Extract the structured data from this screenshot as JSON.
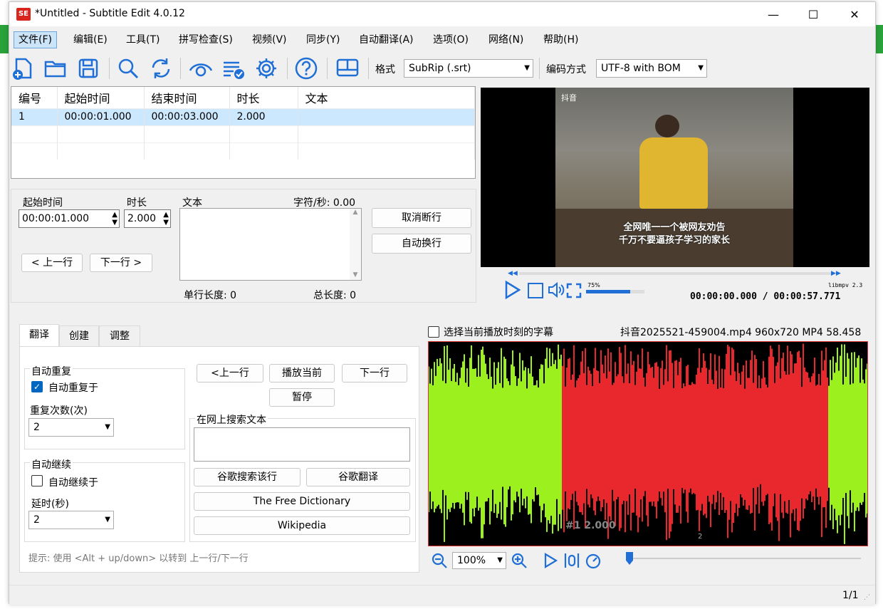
{
  "window": {
    "title": "*Untitled - Subtitle Edit 4.0.12",
    "min": "—",
    "max": "☐",
    "close": "✕",
    "logo": "SE"
  },
  "menu": [
    "文件(F)",
    "编辑(E)",
    "工具(T)",
    "拼写检查(S)",
    "视频(V)",
    "同步(Y)",
    "自动翻译(A)",
    "选项(O)",
    "网络(N)",
    "帮助(H)"
  ],
  "toolbar": {
    "format_label": "格式",
    "format_value": "SubRip (.srt)",
    "encoding_label": "编码方式",
    "encoding_value": "UTF-8 with BOM"
  },
  "grid": {
    "headers": [
      "编号",
      "起始时间",
      "结束时间",
      "时长",
      "文本"
    ],
    "rows": [
      [
        "1",
        "00:00:01.000",
        "00:00:03.000",
        "2.000",
        ""
      ]
    ]
  },
  "edit": {
    "start_label": "起始时间",
    "duration_label": "时长",
    "text_label": "文本",
    "cps": "字符/秒: 0.00",
    "start_value": "00:00:01.000",
    "duration_value": "2.000",
    "unbreak": "取消断行",
    "autobreak": "自动换行",
    "prev": "< 上一行",
    "next": "下一行 >",
    "line_len": "单行长度: 0",
    "total_len": "总长度: 0"
  },
  "video": {
    "watermark": "抖音",
    "sub1": "全网唯一一个被网友劝告",
    "sub2": "千万不要逼孩子学习的家长",
    "volume": "75%",
    "engine": "libmpv 2.3",
    "time": "00:00:00.000 / 00:00:57.771"
  },
  "tabs": [
    "翻译",
    "创建",
    "调整"
  ],
  "translate": {
    "repeat_group": "自动重复",
    "repeat_chk": "自动重复于",
    "repeat_count_label": "重复次数(次)",
    "repeat_count": "2",
    "continue_group": "自动继续",
    "continue_chk": "自动继续于",
    "delay_label": "延时(秒)",
    "delay": "2",
    "prev": "<上一行",
    "play": "播放当前",
    "next": "下一行",
    "pause": "暂停",
    "search_group": "在网上搜索文本",
    "google_search": "谷歌搜索该行",
    "google_translate": "谷歌翻译",
    "free_dict": "The Free Dictionary",
    "wiki": "Wikipedia",
    "hint": "提示: 使用 <Alt + up/down> 以转到 上一行/下一行"
  },
  "waveform": {
    "select_chk": "选择当前播放时刻的字幕",
    "file_info": "抖音2025521-459004.mp4 960x720 MP4 58.458",
    "marker": "#1  2.000",
    "tick": "2",
    "zoom": "100%"
  },
  "status": {
    "page": "1/1"
  },
  "colors": {
    "accent": "#0067c0",
    "wave_green": "#9cf01e",
    "wave_red": "#e8282c",
    "selection": "#cce8ff"
  }
}
